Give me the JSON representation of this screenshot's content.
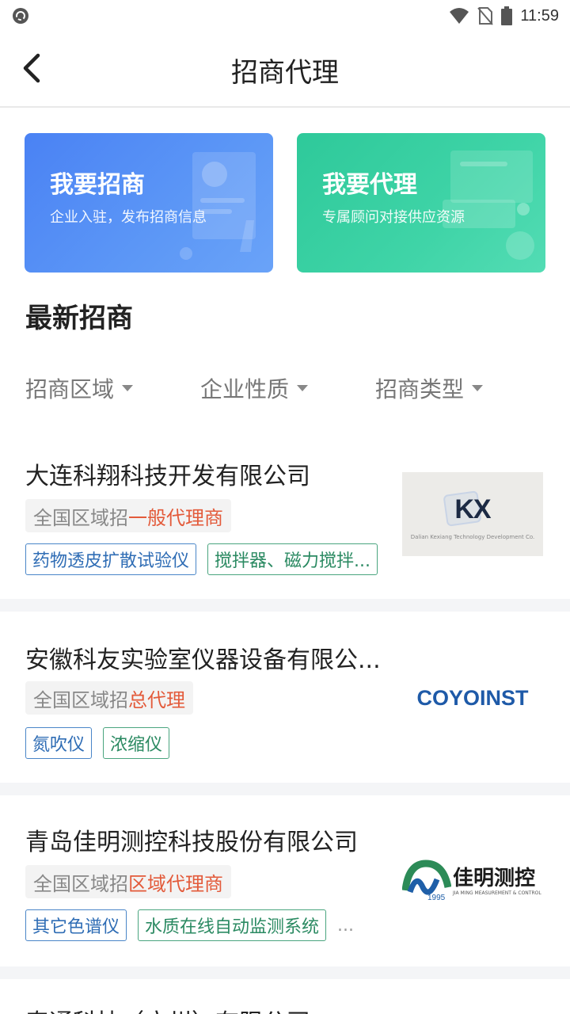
{
  "status_bar": {
    "time": "11:59"
  },
  "header": {
    "title": "招商代理"
  },
  "banners": [
    {
      "title": "我要招商",
      "subtitle": "企业入驻，发布招商信息"
    },
    {
      "title": "我要代理",
      "subtitle": "专属顾问对接供应资源"
    }
  ],
  "section": {
    "title": "最新招商"
  },
  "filters": [
    {
      "label": "招商区域"
    },
    {
      "label": "企业性质"
    },
    {
      "label": "招商类型"
    }
  ],
  "companies": [
    {
      "name": "大连科翔科技开发有限公司",
      "region_prefix": "全国区域招",
      "agent_type": "一般代理商",
      "tags": [
        "药物透皮扩散试验仪",
        "搅拌器、磁力搅拌..."
      ],
      "logo_text": "KX",
      "logo_sub": "Dalian Kexiang Technology Development Co."
    },
    {
      "name": "安徽科友实验室仪器设备有限公...",
      "region_prefix": "全国区域招",
      "agent_type": "总代理",
      "tags": [
        "氮吹仪",
        "浓缩仪"
      ],
      "logo_text": "COYOINST"
    },
    {
      "name": "青岛佳明测控科技股份有限公司",
      "region_prefix": "全国区域招",
      "agent_type": "区域代理商",
      "tags": [
        "其它色谱仪",
        "水质在线自动监测系统"
      ],
      "more": "...",
      "logo_text": "佳明测控",
      "logo_year": "1995",
      "logo_sub": "JIA MING MEASUREMENT & CONTROL"
    },
    {
      "name": "泰通科技（广州）有限公司"
    }
  ],
  "colors": {
    "primary_blue": "#4a82f4",
    "primary_green": "#2ec99a",
    "accent_red": "#e35a3a"
  }
}
